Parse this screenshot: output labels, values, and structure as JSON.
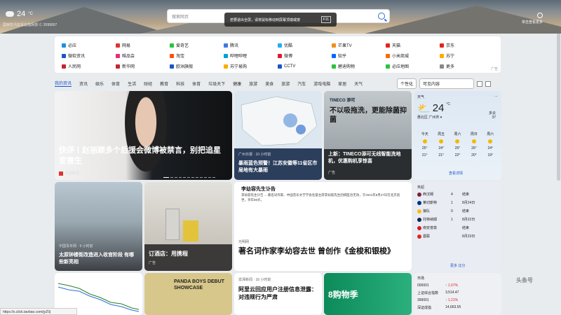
{
  "header": {
    "temperature": "24",
    "temp_unit": "°C",
    "note": "国家防汛抗旱总指挥部 Ⓒ 2099007",
    "search_placeholder": "搜索网页",
    "toast_text": "若要退出全屏，请将鼠标移动到屏幕顶端或按",
    "toast_key": "F11",
    "right_note": "单击查看更多"
  },
  "quick_links": [
    {
      "label": "必应",
      "color": "#1a8fe3"
    },
    {
      "label": "网易",
      "color": "#d33"
    },
    {
      "label": "爱奇艺",
      "color": "#2ac33b"
    },
    {
      "label": "腾讯",
      "color": "#3b79e8"
    },
    {
      "label": "优酷",
      "color": "#1cb0f6"
    },
    {
      "label": "芒果TV",
      "color": "#f08f1b"
    },
    {
      "label": "天猫",
      "color": "#e1251b"
    },
    {
      "label": "京东",
      "color": "#e1251b"
    },
    {
      "label": "微软资讯",
      "color": "#1a56c5"
    },
    {
      "label": "唯品会",
      "color": "#e92a7a"
    },
    {
      "label": "淘宝",
      "color": "#ff5000"
    },
    {
      "label": "哔哩哔哩",
      "color": "#00a1d6"
    },
    {
      "label": "微博",
      "color": "#e6162d"
    },
    {
      "label": "知乎",
      "color": "#0066ff"
    },
    {
      "label": "小米商城",
      "color": "#ff6700"
    },
    {
      "label": "苏宁",
      "color": "#ffaa00"
    },
    {
      "label": "人民网",
      "color": "#c1272d"
    },
    {
      "label": "新华网",
      "color": "#c1272d"
    },
    {
      "label": "欧洲旗舰",
      "color": "#1a56c5"
    },
    {
      "label": "苏宁易购",
      "color": "#ffaa00"
    },
    {
      "label": "CCTV",
      "color": "#1a56c5"
    },
    {
      "label": "碧迪购物",
      "color": "#2ac33b"
    },
    {
      "label": "必应地图",
      "color": "#2ac33b"
    },
    {
      "label": "更多",
      "color": "#888888"
    }
  ],
  "quick_ad": "广告",
  "nav": {
    "tabs": [
      "我的资讯",
      "资讯",
      "娱乐",
      "体育",
      "生活",
      "财经",
      "教育",
      "科技",
      "体育",
      "垃圾天下",
      "健康",
      "旅游",
      "美食",
      "旅游",
      "汽车",
      "游戏电脑",
      "家居",
      "天气"
    ],
    "personalize": "个性化",
    "select_value": "可见内容"
  },
  "cards": {
    "hero": {
      "title": "快评丨赵丽颖多个后援会微博被禁言，别把追星变害生",
      "source": "红星新闻"
    },
    "map": {
      "title": "暴雨蓝色预警！江苏安徽等11省区市局地有大暴雨",
      "source": "广州日报 · 10 小时前"
    },
    "tineco": {
      "brand": "TINECO 添可",
      "headline": "不以吸拖洗，更能除菌抑菌",
      "title": "上新：TINECO添可无线智能洗地机，优惠购机享惊喜",
      "source": "广告"
    },
    "tower": {
      "title": "太原钟楼街改造进入收官阶段 有哪些新亮相",
      "source": "中国青年网 · 9 小时前"
    },
    "luggage": {
      "title": "订酒店：用携程",
      "source": "广告"
    },
    "article": {
      "lyric_title": "李幼容先生讣告",
      "lyric": "李幼容先生讣告 ... 著名词作家、中国音乐文学学会名誉主席李幼容先生因病医治无效，于2021年8月27日在北京逝世，享年86岁。",
      "title": "著名词作家李幼容去世 曾创作《金梭和银梭》",
      "source": "光明网"
    },
    "panda": {
      "title": "PANDA BOYS DEBUT SHOWCASE"
    },
    "news3": {
      "title": "阿里云回应用户注册信息泄露：对违规行为严肃",
      "source": "澎湃新闻 · 16 小时前"
    },
    "green": {
      "title": "8购物季"
    }
  },
  "weather": {
    "label": "天气",
    "temp": "24",
    "unit": "°C",
    "location": "惠北区 广州市 ▾",
    "condition": "多云",
    "aqi": "37",
    "days": [
      "今天",
      "周五",
      "周六",
      "周日",
      "周六"
    ],
    "highs": [
      "25°",
      "24°",
      "25°",
      "26°",
      "24°"
    ],
    "lows": [
      "21°",
      "21°",
      "22°",
      "20°",
      "19°"
    ],
    "more": "查看详情"
  },
  "sports": {
    "label": "英超",
    "matches": [
      {
        "team": "西汉姆",
        "score": "4",
        "info": "结束",
        "color": "#7a2239"
      },
      {
        "team": "莱切斯特",
        "score": "1",
        "info": "8月24日",
        "color": "#003090"
      },
      {
        "team": "狼队",
        "score": "0",
        "info": "结束",
        "color": "#fdb913"
      },
      {
        "team": "托特纳姆",
        "score": "1",
        "info": "8月22日",
        "color": "#132257"
      },
      {
        "team": "南安普敦",
        "score": "",
        "info": "结束",
        "color": "#d71920"
      },
      {
        "team": "曼联",
        "score": "",
        "info": "8月23日",
        "color": "#da291c"
      }
    ],
    "more": "更多 比分"
  },
  "market": {
    "label": "市场",
    "rows": [
      {
        "code": "000001",
        "name": "上证综合指数",
        "change": "↑ 1.07%",
        "value": "3,514.47"
      },
      {
        "code": "399001",
        "name": "深证成指",
        "change": "↑ 1.21%",
        "value": "14,663.55"
      }
    ]
  },
  "status_url": "https://s.click.taobao.com/jyZ0j",
  "watermark": "头条号"
}
